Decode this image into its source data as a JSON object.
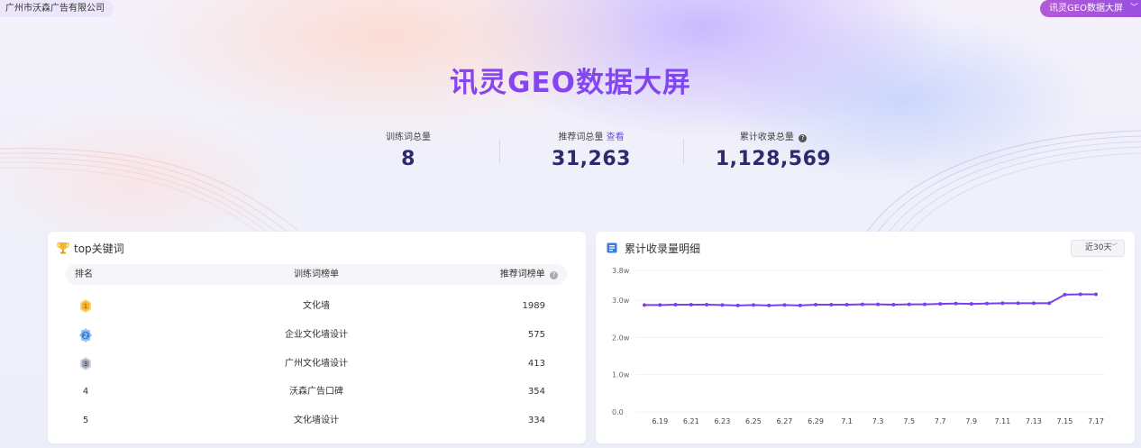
{
  "header": {
    "company": "广州市沃森广告有限公司",
    "screen_button": "讯灵GEO数据大屏",
    "title": "讯灵GEO数据大屏"
  },
  "stats": [
    {
      "label": "训练词总量",
      "value": "8"
    },
    {
      "label": "推荐词总量",
      "link": "查看",
      "value": "31,263"
    },
    {
      "label": "累计收录总量",
      "help": "?",
      "value": "1,128,569"
    }
  ],
  "top_keywords": {
    "title": "top关键词",
    "columns": {
      "rank": "排名",
      "word": "训练词榜单",
      "recommend": "推荐词榜单",
      "help": "?"
    },
    "rows": [
      {
        "rank": "1",
        "word": "文化墙",
        "count": "1989",
        "medal": "gold"
      },
      {
        "rank": "2",
        "word": "企业文化墙设计",
        "count": "575",
        "medal": "blue"
      },
      {
        "rank": "3",
        "word": "广州文化墙设计",
        "count": "413",
        "medal": "silver"
      },
      {
        "rank": "4",
        "word": "沃森广告口碑",
        "count": "354"
      },
      {
        "rank": "5",
        "word": "文化墙设计",
        "count": "334"
      }
    ],
    "medal_colors": {
      "gold": "#f3c64a",
      "blue": "#4a8fe0",
      "silver": "#9ea6b4"
    }
  },
  "accumulated": {
    "title": "累计收录量明细",
    "range": "近30天",
    "accent": "#7b3ff0"
  },
  "chart_data": {
    "type": "line",
    "title": "累计收录量明细",
    "x": [
      "6.18",
      "6.19",
      "6.20",
      "6.21",
      "6.22",
      "6.23",
      "6.24",
      "6.25",
      "6.26",
      "6.27",
      "6.28",
      "6.29",
      "6.30",
      "7.1",
      "7.2",
      "7.3",
      "7.4",
      "7.5",
      "7.6",
      "7.7",
      "7.8",
      "7.9",
      "7.10",
      "7.11",
      "7.12",
      "7.13",
      "7.14",
      "7.15",
      "7.16",
      "7.17"
    ],
    "x_tick_labels": [
      "6.19",
      "6.21",
      "6.23",
      "6.25",
      "6.27",
      "6.29",
      "7.1",
      "7.3",
      "7.5",
      "7.7",
      "7.9",
      "7.11",
      "7.13",
      "7.15",
      "7.17"
    ],
    "y_tick_labels": [
      "0.0",
      "1.0w",
      "2.0w",
      "3.0w",
      "3.8w"
    ],
    "y_ticks": [
      0,
      10000,
      20000,
      30000,
      38000
    ],
    "ylim": [
      0,
      38000
    ],
    "series": [
      {
        "values": [
          28700,
          28700,
          28800,
          28800,
          28800,
          28700,
          28600,
          28700,
          28600,
          28700,
          28600,
          28800,
          28800,
          28800,
          28900,
          28900,
          28800,
          28900,
          28900,
          29000,
          29100,
          29000,
          29100,
          29200,
          29200,
          29200,
          29200,
          31500,
          31600,
          31600
        ]
      }
    ],
    "grid": true,
    "color": "#7b3ff0"
  }
}
